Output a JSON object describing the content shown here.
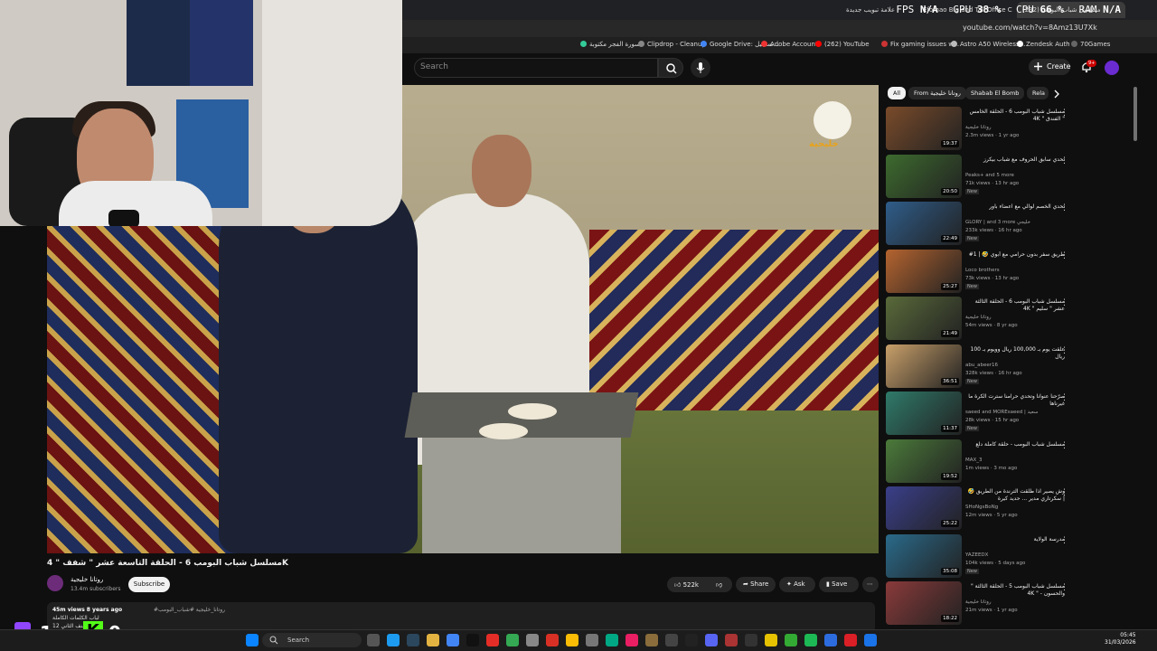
{
  "browser": {
    "tabs": [
      {
        "label": "علامة تبويب جديدة"
      },
      {
        "label": "Efomao Big and Tall Office Chai"
      },
      {
        "label": "(232) مسلسل شباب البومب"
      }
    ],
    "url": "youtube.com/watch?v=8Amz13U7Xk",
    "bookmarks": [
      "سورة الفجر مكتوبة",
      "Clipdrop - Cleanup",
      "Google Drive: تسجيل...",
      "Adobe Account",
      "(262) YouTube",
      "Fix gaming issues w...",
      "Astro A50 Wireless...",
      "Zendesk Auth",
      "70Games"
    ]
  },
  "perf_overlay": {
    "fps_label": "FPS",
    "fps": "N/A",
    "gpu_label": "GPU",
    "gpu": "38 %",
    "cpu_label": "CPU",
    "cpu": "66 %",
    "ram_label": "RAM",
    "ram": "N/A"
  },
  "youtube": {
    "search_placeholder": "Search",
    "create_label": "Create",
    "notif_count": "9+"
  },
  "video": {
    "watermark": "خليجية",
    "title": "مسلسل شباب البومب 6 - الحلقة التاسعة عشر \" شفف \" 4K",
    "channel": "روتانا خليجية",
    "subscribers": "13.4m subscribers",
    "subscribe_label": "Subscribe",
    "likes": "522k",
    "share_label": "Share",
    "ask_label": "Ask",
    "save_label": "Save",
    "views": "45m views",
    "age": "8 years ago",
    "tags": "#روتانا_خليجية #شباب_البومب",
    "desc_line2": "لباب الكلمات الكاملة",
    "desc_line3": "12 الصنف الثاني"
  },
  "stream_overlay": {
    "twitch_count": "1",
    "kick_count": "0"
  },
  "chips": [
    {
      "label": "All",
      "active": true
    },
    {
      "label": "From روتانا خليجية",
      "active": false
    },
    {
      "label": "Shabab El Bomb",
      "active": false
    },
    {
      "label": "Rela",
      "active": false
    }
  ],
  "recommendations": [
    {
      "title": "مسلسل شباب البومب 6 - الحلقة الخامس \" الفندق \" 4K",
      "channel": "روتانا خليجية",
      "meta": "2.3m views · 1 yr ago",
      "duration": "19:37",
      "new": "",
      "thumb_color": "#7a4b2a"
    },
    {
      "title": "تحدي سابق الحروف مع شباب بيكرز",
      "channel": "Peaks+ and 5 more",
      "meta": "71k views · 13 hr ago",
      "duration": "20:50",
      "new": "New",
      "thumb_color": "#3d6b2e"
    },
    {
      "title": "تحدي الخصم لوالي مع اعضاء باور",
      "channel": "GLORY | and 3 more خليجي",
      "meta": "233k views · 16 hr ago",
      "duration": "22:49",
      "new": "New",
      "thumb_color": "#2f5d8a"
    },
    {
      "title": "طريق سفر بدون حرامي مع أبوي 🤣 | 1#",
      "channel": "Loco brothers",
      "meta": "73k views · 13 hr ago",
      "duration": "25:27",
      "new": "New",
      "thumb_color": "#b5642f"
    },
    {
      "title": "مسلسل شباب البومب 6 - الحلقة الثالثة عشر \" سليم \" 4K",
      "channel": "روتانا خليجية",
      "meta": "54m views · 8 yr ago",
      "duration": "21:49",
      "new": "",
      "thumb_color": "#5a6a3a"
    },
    {
      "title": "علقت يوم بـ 100,000 ريال وويوم بـ 100 ريال",
      "channel": "abu_abeer16",
      "meta": "328k views · 16 hr ago",
      "duration": "36:51",
      "new": "New",
      "thumb_color": "#c9a06a"
    },
    {
      "title": "صرّحنا عنوانا وتحدي حرامنا سترت الكرة ما غيرناها",
      "channel": "saeed and MOREsaeed | سعيد",
      "meta": "28k views · 15 hr ago",
      "duration": "11:37",
      "new": "New",
      "thumb_color": "#2f7a6a"
    },
    {
      "title": "مسلسل شباب البومب - حلقة كاملة دلع",
      "channel": "MAX_3",
      "meta": "1m views · 3 mo ago",
      "duration": "19:52",
      "new": "",
      "thumb_color": "#4b7a3a"
    },
    {
      "title": "وش يصير اذا طلقت الترندة من الطريق 🤣 | سكرتاري مدير ... حديد كيرة",
      "channel": "SHoNgsBoNg",
      "meta": "12m views · 5 yr ago",
      "duration": "25:22",
      "new": "",
      "thumb_color": "#3a3f8a"
    },
    {
      "title": "مدرسة الولاية",
      "channel": "YAZEEDX",
      "meta": "104k views · 5 days ago",
      "duration": "35:08",
      "new": "New",
      "thumb_color": "#2a6a8a"
    },
    {
      "title": "مسلسل شباب البومب 5 - الحلقة الثالثة \" والحسون - \" 4K",
      "channel": "روتانا خليجية",
      "meta": "21m views · 1 yr ago",
      "duration": "18:22",
      "new": "",
      "thumb_color": "#8a3a3a"
    }
  ],
  "taskbar": {
    "search_label": "Search",
    "time": "05:45",
    "date": "31/03/2026"
  }
}
